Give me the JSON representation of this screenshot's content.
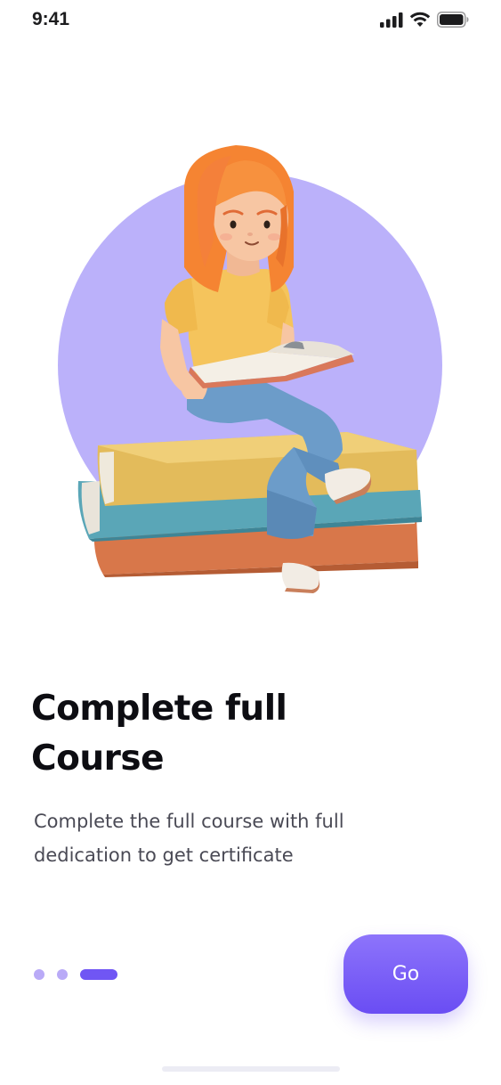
{
  "status_bar": {
    "time": "9:41",
    "icons": [
      "cellular-signal-icon",
      "wifi-icon",
      "battery-icon"
    ]
  },
  "hero": {
    "illustration": "girl-reading-on-books-illustration",
    "circle_color": "#bbb1fa"
  },
  "onboarding": {
    "title_line1": "Complete full",
    "title_line2": "Course",
    "description_line1": "Complete the full course with full",
    "description_line2": "dedication to get certificate"
  },
  "pager": {
    "total": 3,
    "active_index": 2
  },
  "go_button": {
    "label": "Go"
  },
  "colors": {
    "accent": "#7056f4",
    "accent_light": "#b9aaf7",
    "title": "#0d0d12",
    "body_text": "#4a4a55"
  }
}
